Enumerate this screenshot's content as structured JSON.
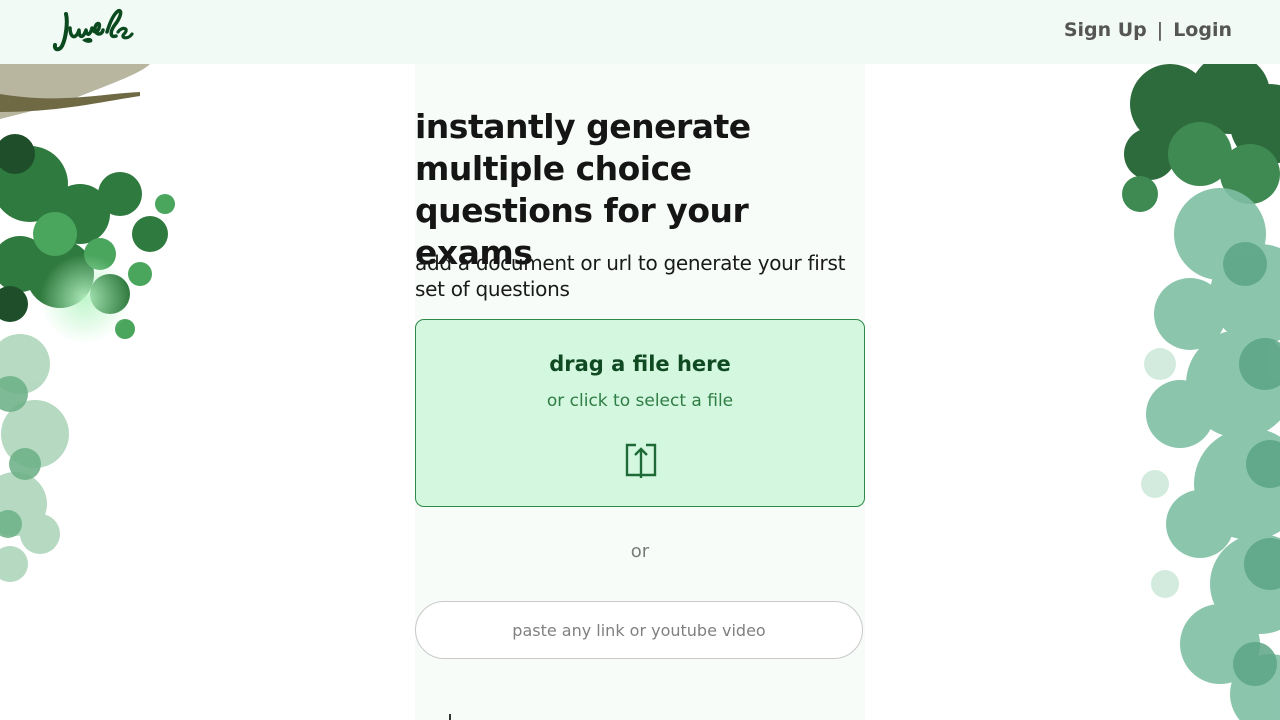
{
  "header": {
    "logo_text": "Jungle",
    "signup_label": "Sign Up",
    "separator": "|",
    "login_label": "Login"
  },
  "hero": {
    "headline": "instantly generate multiple choice questions for your exams",
    "subtitle": "add a document or url to generate your first set of questions"
  },
  "upload": {
    "title": "drag a file here",
    "subtitle": "or click to select a file",
    "icon": "upload-icon"
  },
  "divider_text": "or",
  "link_input": {
    "placeholder": "paste any link or youtube video",
    "value": ""
  },
  "colors": {
    "header_bg": "#f1faf4",
    "brand_green": "#0f4a22",
    "dropzone_bg": "#d4f7df",
    "dropzone_border": "#2d8a4a"
  }
}
